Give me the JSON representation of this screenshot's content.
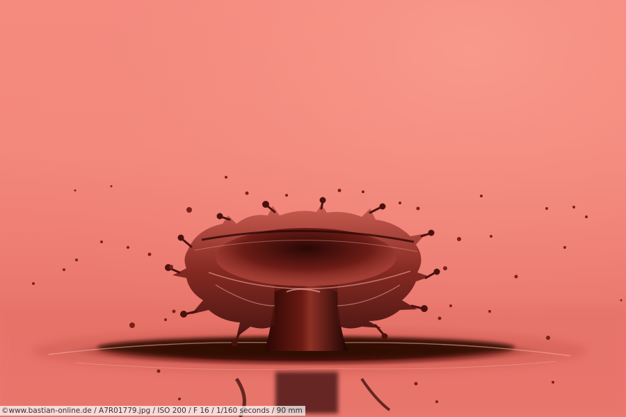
{
  "photo": {
    "subject": "water-drop-splash-crown",
    "colors": {
      "background": "#f3887c",
      "liquid_dark": "#3a0c0a",
      "liquid_mid": "#8c2a24",
      "highlight": "#ffb3a8"
    }
  },
  "caption": {
    "text": "©www.bastian-online.de / A7R01779.jpg / ISO 200 / F 16 / 1/160 seconds  / 90 mm"
  }
}
